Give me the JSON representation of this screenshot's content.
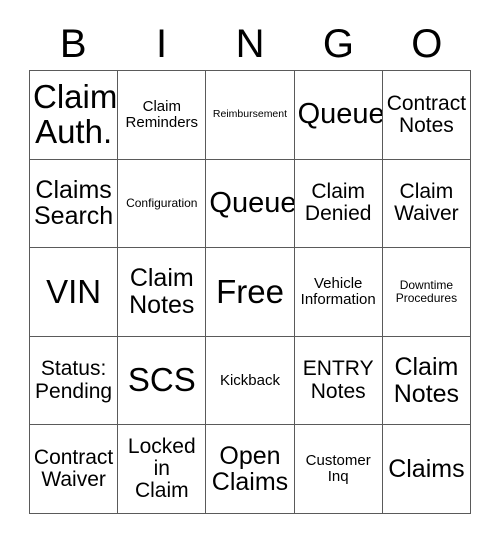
{
  "card": {
    "title": "BINGO Card",
    "columns": [
      "B",
      "I",
      "N",
      "G",
      "O"
    ],
    "free_space_label": "Free",
    "rows": [
      [
        {
          "text": "Claim\nAuth.",
          "size": "xxl"
        },
        {
          "text": "Claim\nReminders",
          "size": "sm"
        },
        {
          "text": "Reimbursement",
          "size": "xxs"
        },
        {
          "text": "Queue",
          "size": "xl"
        },
        {
          "text": "Contract\nNotes",
          "size": "md"
        }
      ],
      [
        {
          "text": "Claims\nSearch",
          "size": "lg"
        },
        {
          "text": "Configuration",
          "size": "xs"
        },
        {
          "text": "Queue",
          "size": "xl"
        },
        {
          "text": "Claim\nDenied",
          "size": "md"
        },
        {
          "text": "Claim\nWaiver",
          "size": "md"
        }
      ],
      [
        {
          "text": "VIN",
          "size": "xxl"
        },
        {
          "text": "Claim\nNotes",
          "size": "lg"
        },
        {
          "text": "Free",
          "size": "xxl"
        },
        {
          "text": "Vehicle\nInformation",
          "size": "sm"
        },
        {
          "text": "Downtime\nProcedures",
          "size": "xs"
        }
      ],
      [
        {
          "text": "Status:\nPending",
          "size": "md"
        },
        {
          "text": "SCS",
          "size": "xxl"
        },
        {
          "text": "Kickback",
          "size": "sm"
        },
        {
          "text": "ENTRY\nNotes",
          "size": "md"
        },
        {
          "text": "Claim\nNotes",
          "size": "lg"
        }
      ],
      [
        {
          "text": "Contract\nWaiver",
          "size": "md"
        },
        {
          "text": "Locked\nin\nClaim",
          "size": "md"
        },
        {
          "text": "Open\nClaims",
          "size": "lg"
        },
        {
          "text": "Customer\nInq",
          "size": "sm"
        },
        {
          "text": "Claims",
          "size": "lg"
        }
      ]
    ]
  },
  "colors": {
    "text": "#000000",
    "grid_line": "#5a5a5a",
    "background": "#ffffff"
  }
}
